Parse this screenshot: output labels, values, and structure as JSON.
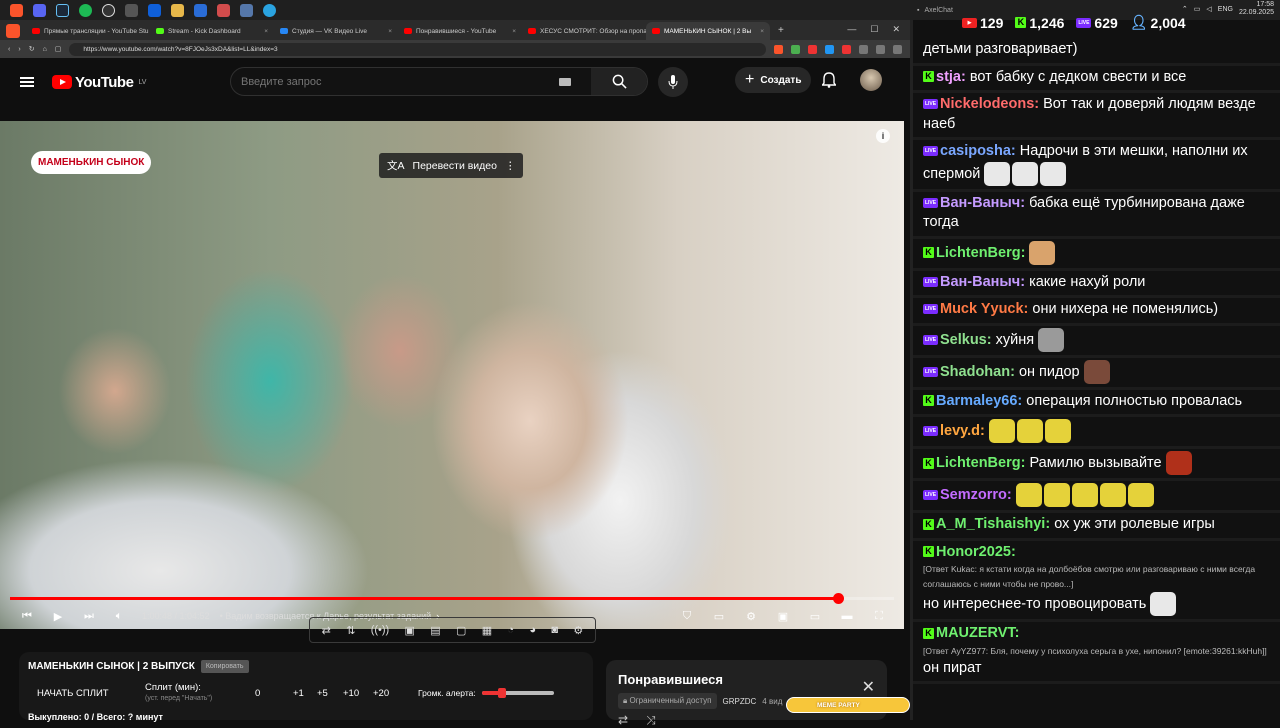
{
  "taskbar": {
    "clock_time": "17:58",
    "clock_date": "22.09.2025",
    "lang": "ENG"
  },
  "browser": {
    "tabs": [
      {
        "label": "Прямые трансляции - YouTube Stu",
        "kind": "yt"
      },
      {
        "label": "Stream - Kick Dashboard",
        "kind": "kick"
      },
      {
        "label": "Студия — VK Видео Live",
        "kind": "vk"
      },
      {
        "label": "Понравившиеся - YouTube",
        "kind": "yt"
      },
      {
        "label": "ХЕСУС СМОТРИТ: Обзор на пропа",
        "kind": "yt"
      },
      {
        "label": "МАМЕНЬКИН СЫНОК | 2 Вы",
        "kind": "yt",
        "active": true
      }
    ],
    "url": "https://www.youtube.com/watch?v=8FJOeJs3xDA&list=LL&index=3"
  },
  "youtube": {
    "logo": "YouTube",
    "region": "LV",
    "search_placeholder": "Введите запрос",
    "create_label": "Создать"
  },
  "video": {
    "show_badge": "МАМЕНЬКИН СЫНОК",
    "translate_label": "Перевести видео",
    "time": "1:00:48 / 1:04:52",
    "chapter": "• Вадим возвращается к Дарье, результат заданий",
    "progress_fraction": 0.937
  },
  "split_panel": {
    "title": "МАМЕНЬКИН СЫНОК | 2 ВЫПУСК",
    "copy_label": "Копировать",
    "start_label": "НАЧАТЬ СПЛИТ",
    "split_label": "Сплит (мин):",
    "split_sub": "(уст. перед \"Начать\")",
    "value": "0",
    "steps": [
      "+1",
      "+5",
      "+10",
      "+20"
    ],
    "alert_label": "Громк. алерта:",
    "footer": "Выкуплено: 0 / Всего: ? минут"
  },
  "liked": {
    "title": "Понравившиеся",
    "access": "Ограниченный доступ",
    "owner": "GRPZDC",
    "count": "4 вид",
    "meme": "MEME PARTY"
  },
  "chat_stats": {
    "youtube": "129",
    "kick": "1,246",
    "vk": "629",
    "viewers": "2,004"
  },
  "chat": [
    {
      "platform": "",
      "user": "",
      "color": "#ffffff",
      "text": "детьми разговаривает)"
    },
    {
      "platform": "kick",
      "user": "stja:",
      "color": "#f0a0ff",
      "text": "вот бабку с дедком свести и все"
    },
    {
      "platform": "vk",
      "user": "Nickelodeons:",
      "color": "#ff6b6b",
      "text": "Вот так и доверяй людям везде наеб"
    },
    {
      "platform": "vk",
      "user": "casiposha:",
      "color": "#7aa7ff",
      "text": "Надрочи в эти мешки, наполни их спермой",
      "emotes": [
        "#e8e8e8",
        "#e8e8e8",
        "#e8e8e8"
      ]
    },
    {
      "platform": "vk",
      "user": "Ван-Ваныч:",
      "color": "#c49aff",
      "text": "бабка ещё турбинирована даже тогда"
    },
    {
      "platform": "kick",
      "user": "LichtenBerg:",
      "color": "#6ff06f",
      "text": "",
      "emotes": [
        "#d9a36c"
      ]
    },
    {
      "platform": "vk",
      "user": "Ван-Ваныч:",
      "color": "#c49aff",
      "text": "какие нахуй роли"
    },
    {
      "platform": "vk",
      "user": "Muck Yyuck:",
      "color": "#ff7a45",
      "text": "они нихера не поменялись)"
    },
    {
      "platform": "vk",
      "user": "Selkus:",
      "color": "#8fe08f",
      "text": "хуйня",
      "emotes": [
        "#9a9a9a"
      ]
    },
    {
      "platform": "vk",
      "user": "Shadohan:",
      "color": "#8fe08f",
      "text": "он пидор",
      "emotes": [
        "#7a4a3a"
      ]
    },
    {
      "platform": "kick",
      "user": "Barmaley66:",
      "color": "#66aaff",
      "text": "операция полностью провалась"
    },
    {
      "platform": "vk",
      "user": "levy.d:",
      "color": "#ffa640",
      "text": "",
      "emotes": [
        "#e5d23a",
        "#e5d23a",
        "#e5d23a"
      ]
    },
    {
      "platform": "kick",
      "user": "LichtenBerg:",
      "color": "#6ff06f",
      "text": "Рамилю вызывайте",
      "emotes": [
        "#b0301a"
      ]
    },
    {
      "platform": "vk",
      "user": "Semzorro:",
      "color": "#c46cff",
      "text": "",
      "emotes": [
        "#e5d23a",
        "#e5d23a",
        "#e5d23a",
        "#e5d23a",
        "#e5d23a"
      ]
    },
    {
      "platform": "kick",
      "user": "A_M_Tishaishyi:",
      "color": "#6ff06f",
      "text": "ох уж эти ролевые игры"
    },
    {
      "platform": "kick",
      "user": "Honor2025:",
      "color": "#6ff06f",
      "text": "",
      "reply": "[Ответ Kukac: я кстати когда на долбоёбов смотрю или разговариваю с ними всегда соглашаюсь с ними чтобы не прово...]",
      "after": "но интереснее-то провоцировать",
      "emotes": [
        "#e8e8e8"
      ]
    },
    {
      "platform": "kick",
      "user": "MAUZERVT:",
      "color": "#6ff06f",
      "text": "",
      "reply": "[Ответ AyYZ977: Бля, почему у психолуха серьга в ухе, нипонил? [emote:39261:kkHuh]]",
      "after": "он пират"
    }
  ]
}
